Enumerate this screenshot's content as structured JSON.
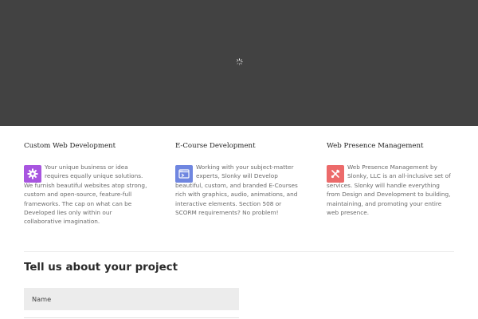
{
  "hero": {
    "loading_icon": "spinner-icon",
    "background": "#424242"
  },
  "services": [
    {
      "title": "Custom Web Development",
      "icon": "gear-icon",
      "icon_color": "#a855e0",
      "text": "Your unique business or idea requires equally unique solutions. We furnish beautiful websites atop strong, custom and open-source, feature-full frameworks. The cap on what can be Developed lies only within our collaborative imagination."
    },
    {
      "title": "E-Course Development",
      "icon": "browser-window-icon",
      "icon_color": "#6f86e0",
      "text": "Working with your subject-matter experts, Slonky will Develop beautiful, custom, and branded E-Courses rich with graphics, audio, animations, and interactive elements. Section 508 or SCORM requirements? No problem!"
    },
    {
      "title": "Web Presence Management",
      "icon": "tools-icon",
      "icon_color": "#ec6a6a",
      "text": "Web Presence Management by Slonky, LLC is an all-inclusive set of services. Slonky will handle everything from Design and Development to building, maintaining, and promoting your entire web presence."
    }
  ],
  "contact": {
    "title": "Tell us about your project",
    "name_placeholder": "Name"
  }
}
